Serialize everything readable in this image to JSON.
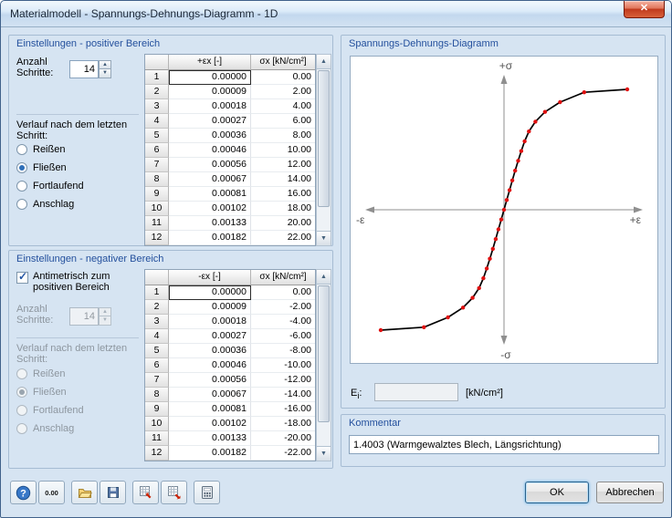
{
  "window": {
    "title": "Materialmodell - Spannungs-Dehnungs-Diagramm - 1D"
  },
  "icons": {
    "close": "✕",
    "help": "?",
    "check": "✓",
    "scroll_up": "▲",
    "scroll_down": "▼",
    "spin_up": "▲",
    "spin_down": "▼"
  },
  "positive": {
    "title": "Einstellungen - positiver Bereich",
    "steps_label_1": "Anzahl",
    "steps_label_2": "Schritte:",
    "steps_value": "14",
    "after_label_1": "Verlauf nach dem letzten",
    "after_label_2": "Schritt:",
    "options": [
      "Reißen",
      "Fließen",
      "Fortlaufend",
      "Anschlag"
    ],
    "selected_option": "Fließen",
    "table": {
      "headers": [
        "",
        "+εx [-]",
        "σx [kN/cm²]"
      ],
      "rows": [
        [
          "1",
          "0.00000",
          "0.00"
        ],
        [
          "2",
          "0.00009",
          "2.00"
        ],
        [
          "3",
          "0.00018",
          "4.00"
        ],
        [
          "4",
          "0.00027",
          "6.00"
        ],
        [
          "5",
          "0.00036",
          "8.00"
        ],
        [
          "6",
          "0.00046",
          "10.00"
        ],
        [
          "7",
          "0.00056",
          "12.00"
        ],
        [
          "8",
          "0.00067",
          "14.00"
        ],
        [
          "9",
          "0.00081",
          "16.00"
        ],
        [
          "10",
          "0.00102",
          "18.00"
        ],
        [
          "11",
          "0.00133",
          "20.00"
        ],
        [
          "12",
          "0.00182",
          "22.00"
        ]
      ]
    }
  },
  "negative": {
    "title": "Einstellungen - negativer Bereich",
    "checkbox_label_1": "Antimetrisch zum",
    "checkbox_label_2": "positiven Bereich",
    "checkbox_checked": true,
    "steps_label_1": "Anzahl",
    "steps_label_2": "Schritte:",
    "steps_value": "14",
    "after_label_1": "Verlauf nach dem letzten",
    "after_label_2": "Schritt:",
    "options": [
      "Reißen",
      "Fließen",
      "Fortlaufend",
      "Anschlag"
    ],
    "selected_option": "Fließen",
    "table": {
      "headers": [
        "",
        "-εx [-]",
        "σx [kN/cm²]"
      ],
      "rows": [
        [
          "1",
          "0.00000",
          "0.00"
        ],
        [
          "2",
          "0.00009",
          "-2.00"
        ],
        [
          "3",
          "0.00018",
          "-4.00"
        ],
        [
          "4",
          "0.00027",
          "-6.00"
        ],
        [
          "5",
          "0.00036",
          "-8.00"
        ],
        [
          "6",
          "0.00046",
          "-10.00"
        ],
        [
          "7",
          "0.00056",
          "-12.00"
        ],
        [
          "8",
          "0.00067",
          "-14.00"
        ],
        [
          "9",
          "0.00081",
          "-16.00"
        ],
        [
          "10",
          "0.00102",
          "-18.00"
        ],
        [
          "11",
          "0.00133",
          "-20.00"
        ],
        [
          "12",
          "0.00182",
          "-22.00"
        ]
      ]
    }
  },
  "diagram": {
    "title": "Spannungs-Dehnungs-Diagramm",
    "ei_label": "E",
    "ei_sub": "i",
    "ei_colon": ":",
    "ei_value": "",
    "ei_unit": "[kN/cm²]"
  },
  "comment": {
    "title": "Kommentar",
    "value": "1.4003 (Warmgewalztes Blech, Längsrichtung)"
  },
  "footer": {
    "ok": "OK",
    "cancel": "Abbrechen",
    "decimal_icon_text": "0.00"
  },
  "chart_data": {
    "type": "line",
    "title": "Spannungs-Dehnungs-Diagramm",
    "axis_labels": {
      "y_pos": "+σ",
      "y_neg": "-σ",
      "x_pos": "+ε",
      "x_neg": "-ε"
    },
    "antimetric": true,
    "x_positive": [
      0,
      9e-05,
      0.00018,
      0.00027,
      0.00036,
      0.00046,
      0.00056,
      0.00067,
      0.00081,
      0.00102,
      0.00133,
      0.00182,
      0.0026,
      0.004
    ],
    "y_positive": [
      0,
      2,
      4,
      6,
      8,
      10,
      12,
      14,
      16,
      18,
      20,
      22,
      24,
      24.6
    ],
    "x_range": [
      -0.004,
      0.004
    ],
    "y_range": [
      -26,
      26
    ],
    "grid": false,
    "legend": false,
    "line_color": "#000000",
    "marker_color": "#e01010",
    "axis_color": "#8f8f8f"
  }
}
